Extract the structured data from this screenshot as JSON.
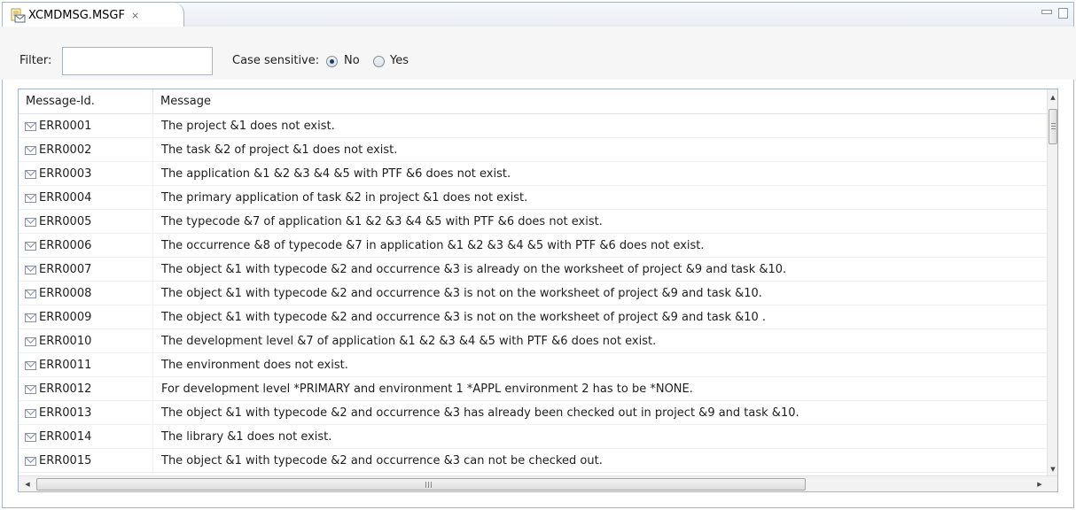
{
  "tab": {
    "title": "XCMDMSG.MSGF",
    "close_glyph": "⨯",
    "icon": "message-file-icon"
  },
  "filter": {
    "label": "Filter:",
    "value": "",
    "placeholder": "",
    "case_label": "Case sensitive:",
    "options": [
      {
        "label": "No",
        "checked": true
      },
      {
        "label": "Yes",
        "checked": false
      }
    ]
  },
  "table": {
    "columns": [
      "Message-Id.",
      "Message"
    ],
    "row_icon": "envelope-icon",
    "rows": [
      {
        "id": "ERR0001",
        "message": "The project &1 does not exist."
      },
      {
        "id": "ERR0002",
        "message": "The task &2 of project &1 does not exist."
      },
      {
        "id": "ERR0003",
        "message": "The application &1 &2 &3 &4 &5 with PTF &6 does not exist."
      },
      {
        "id": "ERR0004",
        "message": "The primary application of task &2 in project &1 does not exist."
      },
      {
        "id": "ERR0005",
        "message": "The typecode &7 of application &1 &2 &3 &4 &5 with PTF &6 does not exist."
      },
      {
        "id": "ERR0006",
        "message": "The occurrence &8 of typecode &7 in application &1 &2 &3 &4 &5 with PTF &6 does not exist."
      },
      {
        "id": "ERR0007",
        "message": "The object &1 with typecode &2 and occurrence &3 is already on the worksheet of project &9 and task &10."
      },
      {
        "id": "ERR0008",
        "message": "The object &1 with typecode &2 and occurrence &3 is not on the worksheet of project &9 and task &10."
      },
      {
        "id": "ERR0009",
        "message": "The object &1 with typecode &2 and occurrence &3 is not on the worksheet of project &9 and task &10 ."
      },
      {
        "id": "ERR0010",
        "message": "The development level &7 of application &1 &2 &3 &4 &5 with PTF &6 does not exist."
      },
      {
        "id": "ERR0011",
        "message": "The environment does not exist."
      },
      {
        "id": "ERR0012",
        "message": "For development level *PRIMARY and environment 1 *APPL environment 2 has to be *NONE."
      },
      {
        "id": "ERR0013",
        "message": "The object &1 with typecode &2 and occurrence &3 has already been checked out in project &9 and task &10."
      },
      {
        "id": "ERR0014",
        "message": "The library &1 does not exist."
      },
      {
        "id": "ERR0015",
        "message": "The object &1 with typecode &2 and occurrence &3 can not be checked out."
      }
    ]
  },
  "scrollbars": {
    "up_glyph": "▲",
    "down_glyph": "▼",
    "left_glyph": "◀",
    "right_glyph": "▶"
  }
}
